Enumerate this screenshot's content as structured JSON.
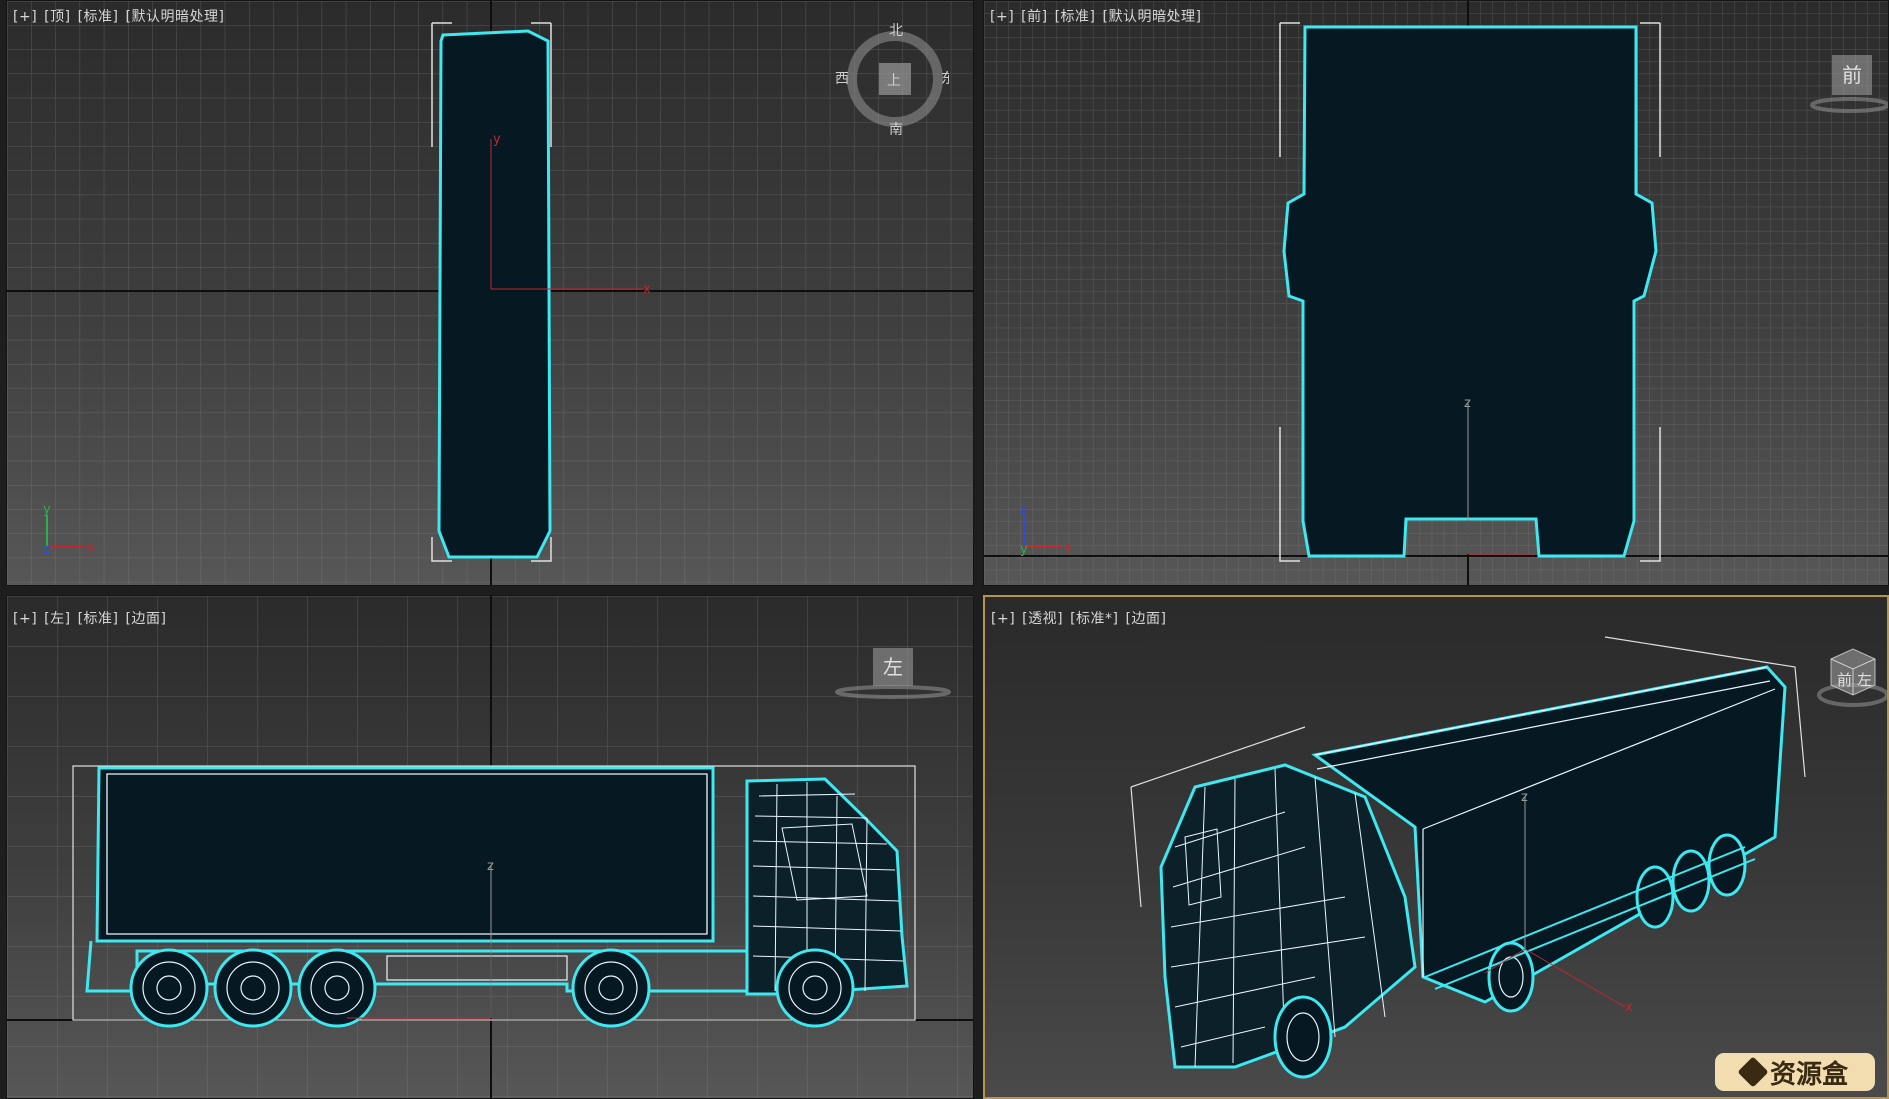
{
  "viewports": {
    "top": {
      "labels": [
        "[+]",
        "[顶]",
        "[标准]",
        "[默认明暗处理]"
      ]
    },
    "front": {
      "labels": [
        "[+]",
        "[前]",
        "[标准]",
        "[默认明暗处理]"
      ]
    },
    "left": {
      "labels": [
        "[+]",
        "[左]",
        "[标准]",
        "[边面]"
      ]
    },
    "persp": {
      "labels": [
        "[+]",
        "[透视]",
        "[标准*]",
        "[边面]"
      ]
    }
  },
  "compass": {
    "north": "北",
    "south": "南",
    "east": "东",
    "west": "西",
    "cube_face": "上"
  },
  "viewcube_front": {
    "face": "前"
  },
  "viewcube_left": {
    "face": "左"
  },
  "viewcube_persp": {
    "face_a": "前",
    "face_b": "左"
  },
  "axes": {
    "x": "x",
    "y": "y",
    "z": "z"
  },
  "watermark": {
    "text": "资源盒"
  },
  "colors": {
    "selection": "#3ee8f0",
    "fill": "#061821",
    "wire": "#e8f6ff",
    "axis_x": "#c4262e",
    "axis_y": "#2bb04a",
    "axis_z": "#2f4cd8",
    "active_border": "#b8934a"
  }
}
